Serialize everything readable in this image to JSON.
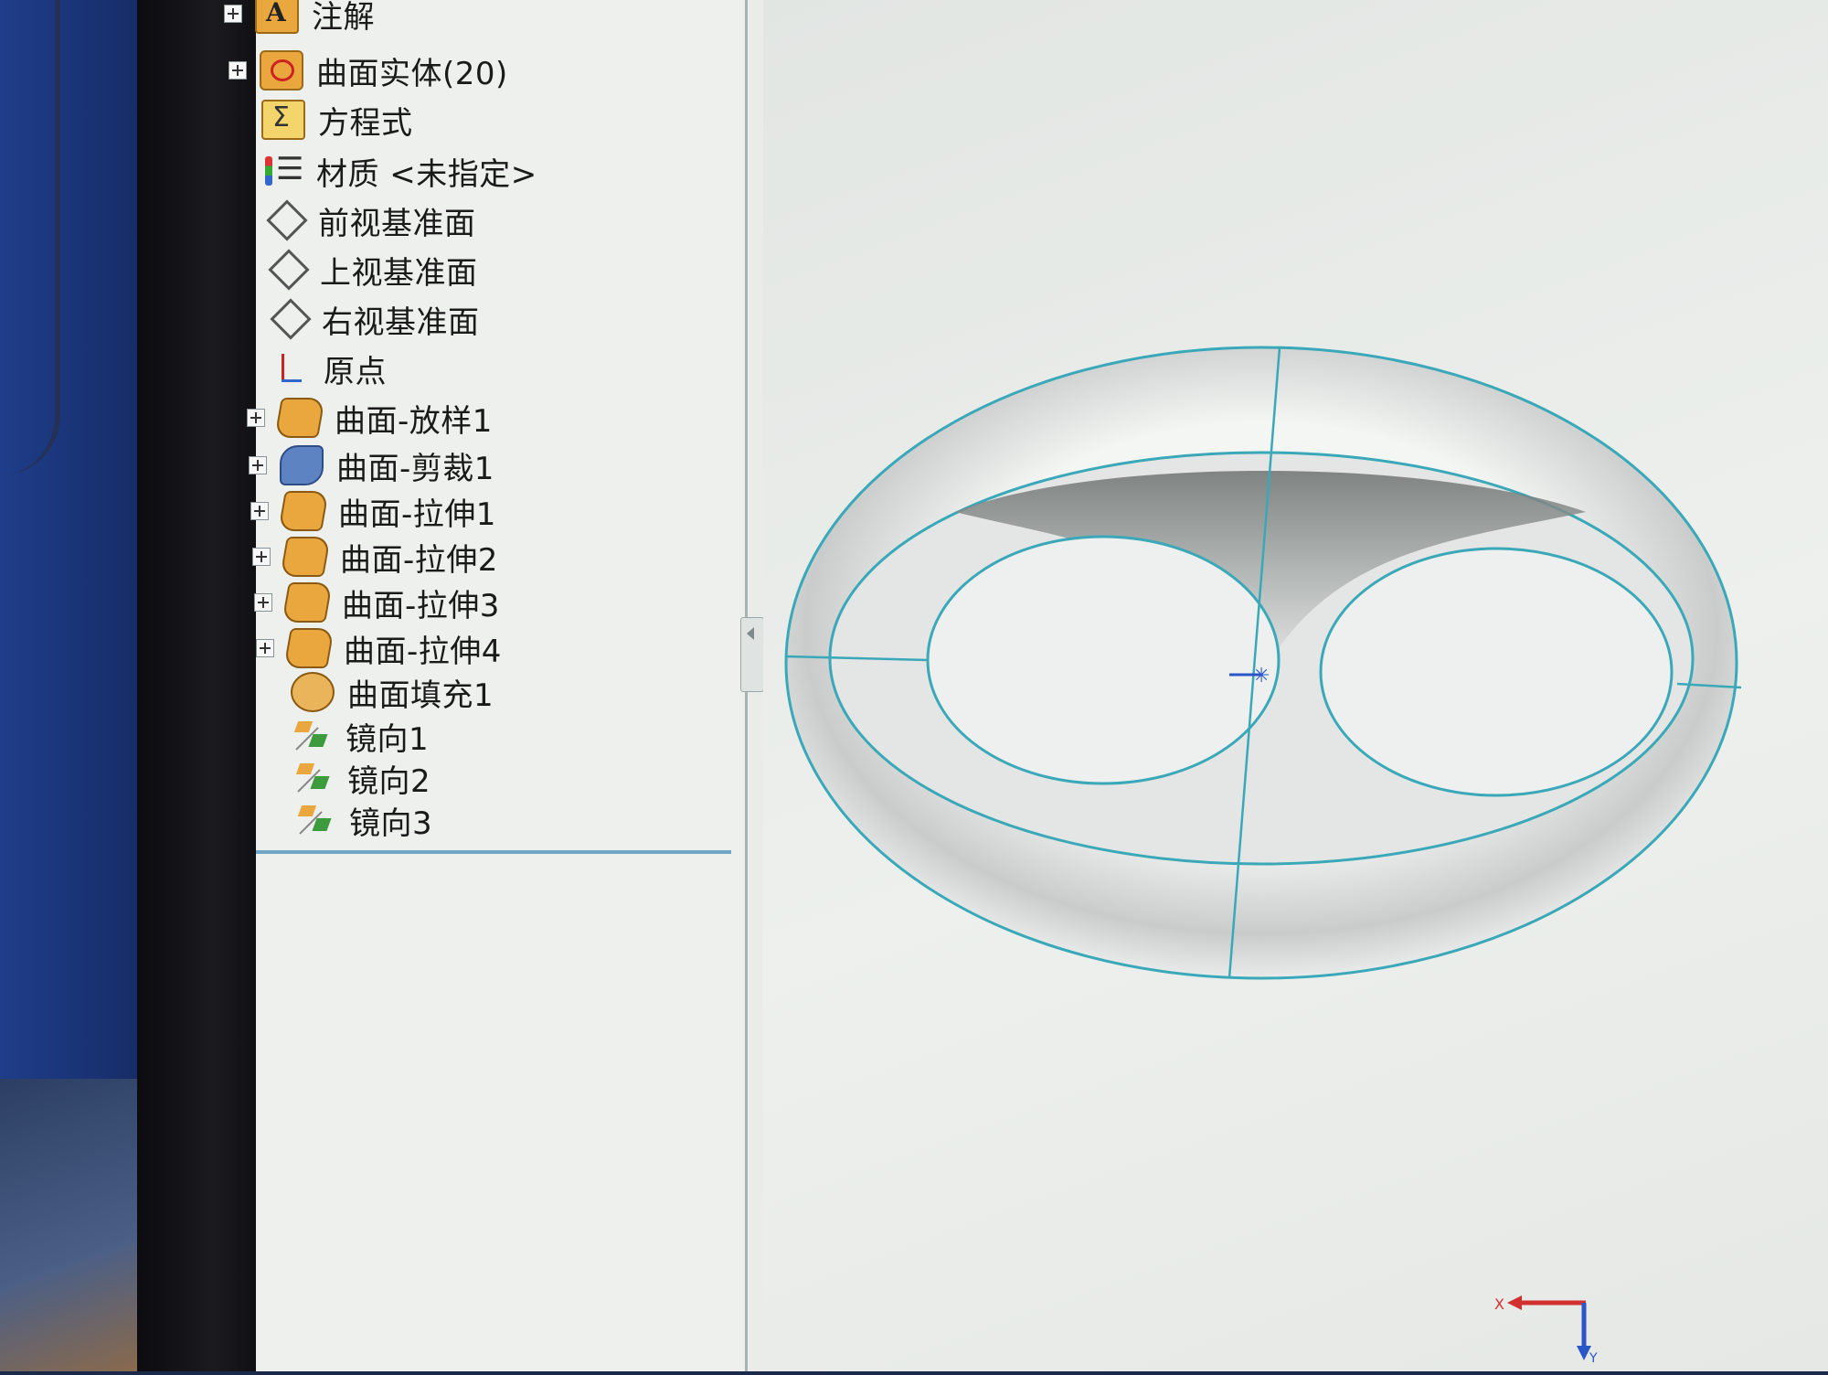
{
  "tree": {
    "items": [
      {
        "label": "注解",
        "icon": "annotations-folder-icon",
        "expandable": true
      },
      {
        "label": "曲面实体(20)",
        "icon": "surface-bodies-folder-icon",
        "expandable": true
      },
      {
        "label": "方程式",
        "icon": "equations-icon",
        "expandable": false
      },
      {
        "label": "材质 <未指定>",
        "icon": "material-icon",
        "expandable": false
      },
      {
        "label": "前视基准面",
        "icon": "plane-icon",
        "expandable": false
      },
      {
        "label": "上视基准面",
        "icon": "plane-icon",
        "expandable": false
      },
      {
        "label": "右视基准面",
        "icon": "plane-icon",
        "expandable": false
      },
      {
        "label": "原点",
        "icon": "origin-icon",
        "expandable": false
      },
      {
        "label": "曲面-放样1",
        "icon": "surface-loft-icon",
        "expandable": true
      },
      {
        "label": "曲面-剪裁1",
        "icon": "surface-trim-icon",
        "expandable": true
      },
      {
        "label": "曲面-拉伸1",
        "icon": "surface-extrude-icon",
        "expandable": true
      },
      {
        "label": "曲面-拉伸2",
        "icon": "surface-extrude-icon",
        "expandable": true
      },
      {
        "label": "曲面-拉伸3",
        "icon": "surface-extrude-icon",
        "expandable": true
      },
      {
        "label": "曲面-拉伸4",
        "icon": "surface-extrude-icon",
        "expandable": true
      },
      {
        "label": "曲面填充1",
        "icon": "surface-fill-icon",
        "expandable": false
      },
      {
        "label": "镜向1",
        "icon": "mirror-icon",
        "expandable": false
      },
      {
        "label": "镜向2",
        "icon": "mirror-icon",
        "expandable": false
      },
      {
        "label": "镜向3",
        "icon": "mirror-icon",
        "expandable": false
      }
    ]
  },
  "triad": {
    "x_label": "X",
    "y_label": "Y"
  },
  "colors": {
    "edge": "#3aa8b8",
    "triad_x": "#d23030",
    "triad_y": "#2a56c8",
    "panel_separator": "#6ea6c6"
  }
}
